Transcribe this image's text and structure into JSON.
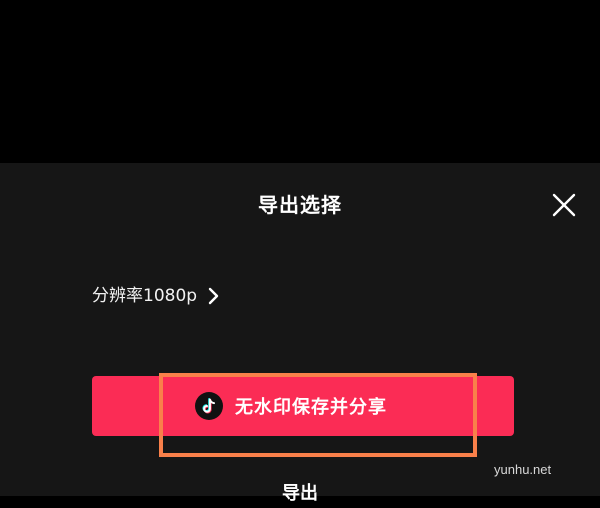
{
  "sheet": {
    "title": "导出选择",
    "resolution_label": "分辨率1080p",
    "share_button_label": "无水印保存并分享",
    "export_label": "导出"
  },
  "watermark": "yunhu.net",
  "icons": {
    "close": "close-icon",
    "chevron": "chevron-right-icon",
    "tiktok": "tiktok-logo-icon"
  },
  "colors": {
    "sheet_background": "#161616",
    "share_button": "#fb2c55",
    "highlight_border": "#f9804a"
  }
}
